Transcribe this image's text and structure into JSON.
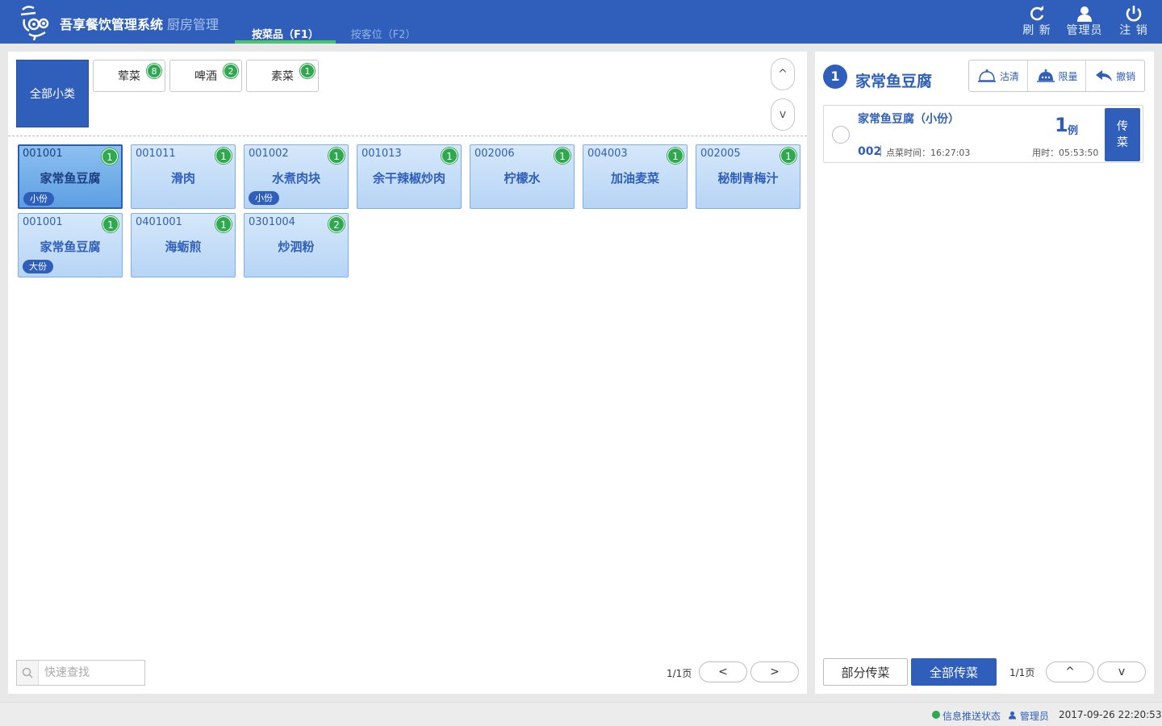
{
  "header": {
    "app_title": "吾享餐饮管理系统",
    "app_subtitle": "厨房管理",
    "tabs": [
      {
        "label": "按菜品（F1）",
        "active": true
      },
      {
        "label": "按客位（F2）",
        "active": false
      }
    ],
    "buttons": {
      "refresh": "刷 新",
      "admin": "管理员",
      "logout": "注 销"
    }
  },
  "categories": {
    "all_label": "全部小类",
    "items": [
      {
        "label": "荤菜",
        "count": "8"
      },
      {
        "label": "啤酒",
        "count": "2"
      },
      {
        "label": "素菜",
        "count": "1"
      }
    ],
    "up_label": "^",
    "down_label": "v"
  },
  "dishes": [
    {
      "code": "001001",
      "name": "家常鱼豆腐",
      "count": "1",
      "size": "小份",
      "selected": true
    },
    {
      "code": "001011",
      "name": "滑肉",
      "count": "1",
      "size": ""
    },
    {
      "code": "001002",
      "name": "水煮肉块",
      "count": "1",
      "size": "小份"
    },
    {
      "code": "001013",
      "name": "余干辣椒炒肉",
      "count": "1",
      "size": ""
    },
    {
      "code": "002006",
      "name": "柠檬水",
      "count": "1",
      "size": ""
    },
    {
      "code": "004003",
      "name": "加油麦菜",
      "count": "1",
      "size": ""
    },
    {
      "code": "002005",
      "name": "秘制青梅汁",
      "count": "1",
      "size": ""
    },
    {
      "code": "001001",
      "name": "家常鱼豆腐",
      "count": "1",
      "size": "大份"
    },
    {
      "code": "0401001",
      "name": "海蛎煎",
      "count": "1",
      "size": ""
    },
    {
      "code": "0301004",
      "name": "炒泗粉",
      "count": "2",
      "size": ""
    }
  ],
  "left_footer": {
    "search_placeholder": "快速查找",
    "page_info": "1/1页",
    "prev_label": "<",
    "next_label": ">"
  },
  "detail": {
    "index": "1",
    "title": "家常鱼豆腐",
    "actions": {
      "clear": "沽清",
      "limit": "限量",
      "undo": "撤销"
    },
    "order": {
      "name": "家常鱼豆腐（小份）",
      "qty": "1",
      "unit": "例",
      "table": "002",
      "order_time": "点菜时间：16:27:03",
      "used_time": "用时：05:53:50",
      "serve_label": "传菜"
    },
    "footer": {
      "partial_label": "部分传菜",
      "all_label": "全部传菜",
      "page_info": "1/1页",
      "up_label": "^",
      "down_label": "v"
    }
  },
  "status_bar": {
    "push_status": "信息推送状态",
    "user": "管理员",
    "datetime": "2017-09-26 22:20:53"
  },
  "colors": {
    "primary": "#2f5fba",
    "badge_green": "#2fa84f",
    "dish_bg": "#c5dcf7"
  }
}
